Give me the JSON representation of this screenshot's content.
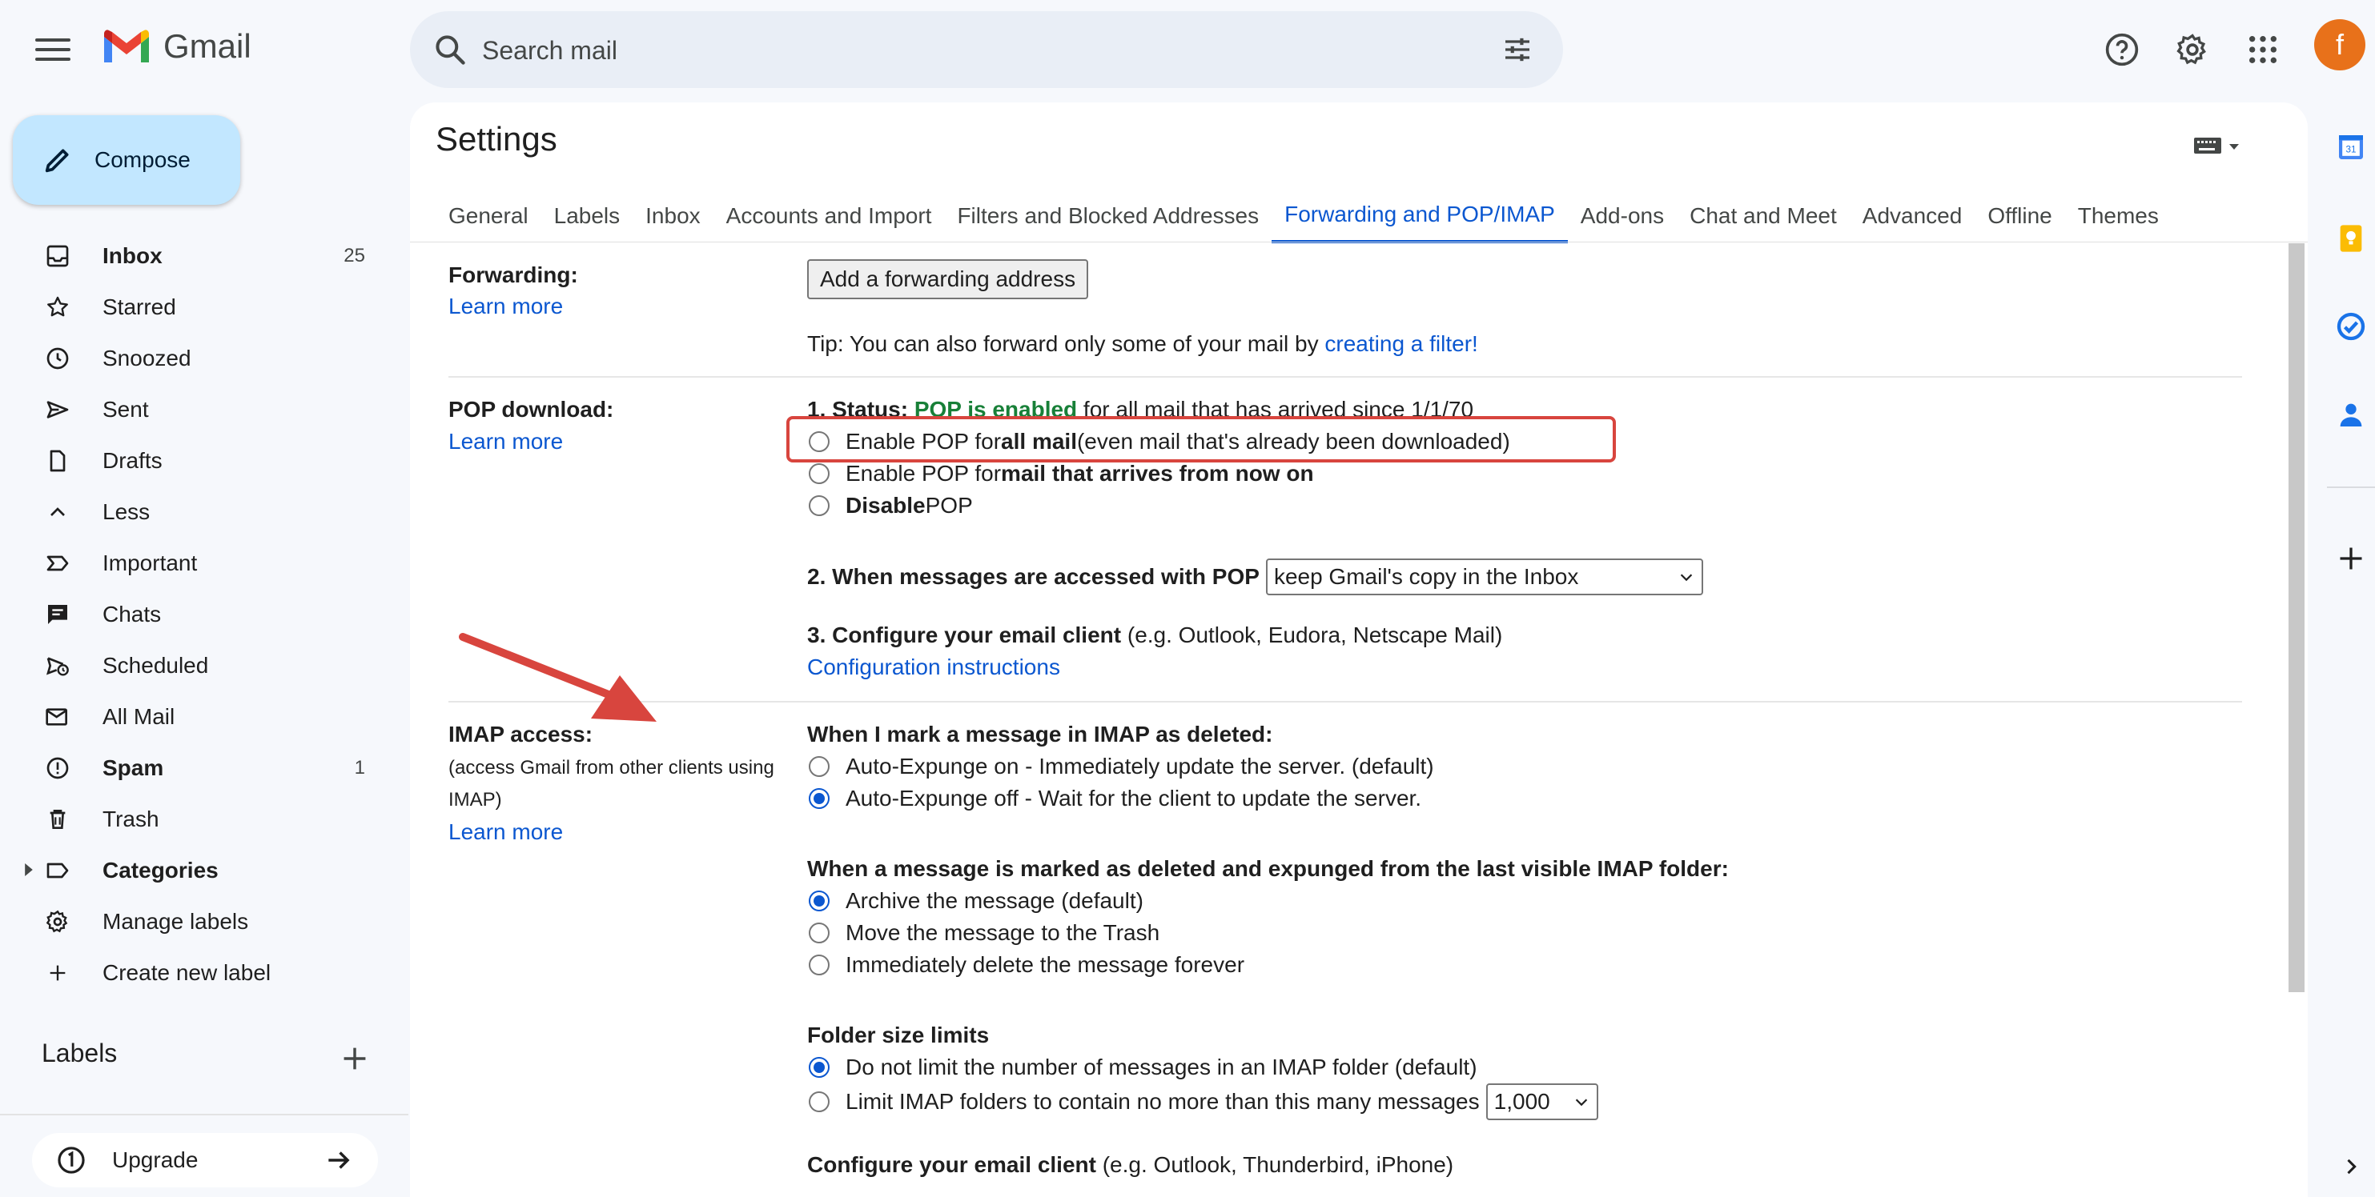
{
  "app": {
    "name": "Gmail"
  },
  "search": {
    "placeholder": "Search mail"
  },
  "account": {
    "initial": "f"
  },
  "compose": {
    "label": "Compose"
  },
  "nav": {
    "items": [
      {
        "label": "Inbox",
        "count": "25"
      },
      {
        "label": "Starred",
        "count": ""
      },
      {
        "label": "Snoozed",
        "count": ""
      },
      {
        "label": "Sent",
        "count": ""
      },
      {
        "label": "Drafts",
        "count": ""
      },
      {
        "label": "Less",
        "count": ""
      },
      {
        "label": "Important",
        "count": ""
      },
      {
        "label": "Chats",
        "count": ""
      },
      {
        "label": "Scheduled",
        "count": ""
      },
      {
        "label": "All Mail",
        "count": ""
      },
      {
        "label": "Spam",
        "count": "1"
      },
      {
        "label": "Trash",
        "count": ""
      },
      {
        "label": "Categories",
        "count": ""
      },
      {
        "label": "Manage labels",
        "count": ""
      },
      {
        "label": "Create new label",
        "count": ""
      }
    ]
  },
  "labels_section": {
    "title": "Labels"
  },
  "upgrade": {
    "label": "Upgrade"
  },
  "settings": {
    "title": "Settings",
    "tabs": [
      "General",
      "Labels",
      "Inbox",
      "Accounts and Import",
      "Filters and Blocked Addresses",
      "Forwarding and POP/IMAP",
      "Add-ons",
      "Chat and Meet",
      "Advanced",
      "Offline",
      "Themes"
    ],
    "active_tab": "Forwarding and POP/IMAP",
    "forwarding": {
      "title": "Forwarding:",
      "learn_more": "Learn more",
      "button": "Add a forwarding address",
      "tip_prefix": "Tip: You can also forward only some of your mail by ",
      "tip_link": "creating a filter!"
    },
    "pop": {
      "title": "POP download:",
      "learn_more": "Learn more",
      "status_label": "1. Status: ",
      "status_value": "POP is enabled",
      "status_rest": " for all mail that has arrived since 1/1/70",
      "opt1_a": "Enable POP for ",
      "opt1_b": "all mail",
      "opt1_c": " (even mail that's already been downloaded)",
      "opt2_a": "Enable POP for ",
      "opt2_b": "mail that arrives from now on",
      "opt3_a": "Disable",
      "opt3_b": " POP",
      "step2_label": "2. When messages are accessed with POP",
      "step2_select": "keep Gmail's copy in the Inbox",
      "step3_label": "3. Configure your email client",
      "step3_rest": " (e.g. Outlook, Eudora, Netscape Mail)",
      "config_link": "Configuration instructions"
    },
    "imap": {
      "title": "IMAP access:",
      "subtitle": "(access Gmail from other clients using IMAP)",
      "learn_more": "Learn more",
      "deleted_heading": "When I mark a message in IMAP as deleted:",
      "deleted_opt1": "Auto-Expunge on - Immediately update the server. (default)",
      "deleted_opt2": "Auto-Expunge off - Wait for the client to update the server.",
      "expunged_heading": "When a message is marked as deleted and expunged from the last visible IMAP folder:",
      "expunged_opt1": "Archive the message (default)",
      "expunged_opt2": "Move the message to the Trash",
      "expunged_opt3": "Immediately delete the message forever",
      "folder_heading": "Folder size limits",
      "folder_opt1": "Do not limit the number of messages in an IMAP folder (default)",
      "folder_opt2": "Limit IMAP folders to contain no more than this many messages",
      "folder_select": "1,000",
      "client_heading": "Configure your email client",
      "client_rest": " (e.g. Outlook, Thunderbird, iPhone)"
    }
  },
  "colors": {
    "accent": "#0b57d0",
    "enabled_green": "#188038",
    "highlight_red": "#d8453e",
    "compose_bg": "#c2e7ff",
    "avatar": "#e8711a"
  }
}
